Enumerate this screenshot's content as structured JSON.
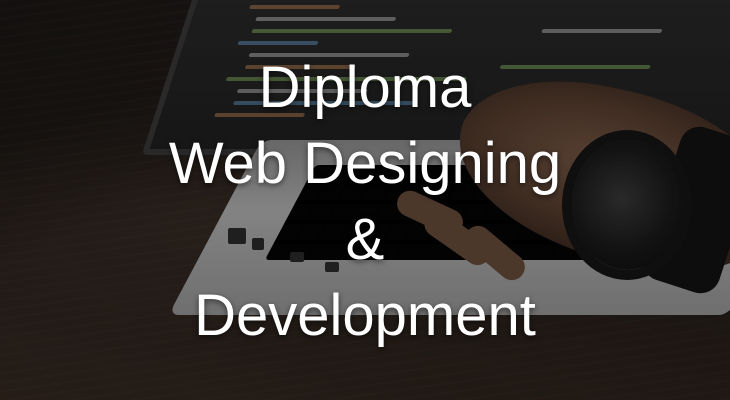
{
  "hero": {
    "line1": "Diploma",
    "line2": "Web Designing",
    "line3": "&",
    "line4": "Development"
  }
}
